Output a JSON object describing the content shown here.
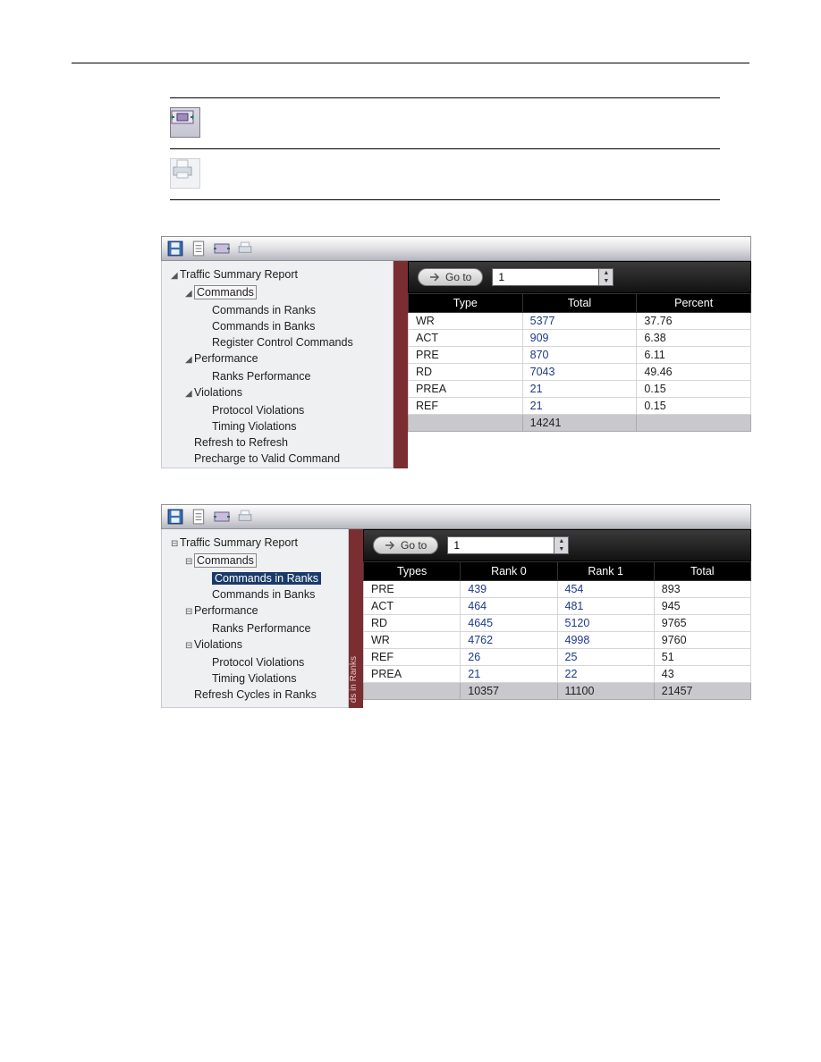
{
  "icons": [
    "expand-icon",
    "print-icon"
  ],
  "screenshot1": {
    "toolbar_icons": [
      "save-icon",
      "doc-icon",
      "expand-icon",
      "print-icon"
    ],
    "tree": [
      {
        "lvl": 1,
        "tw": "◢",
        "label": "Traffic Summary Report"
      },
      {
        "lvl": 2,
        "tw": "◢",
        "label": "Commands",
        "framed": true
      },
      {
        "lvl": 3,
        "tw": "",
        "label": "Commands in Ranks"
      },
      {
        "lvl": 3,
        "tw": "",
        "label": "Commands in Banks"
      },
      {
        "lvl": 3,
        "tw": "",
        "label": "Register Control Commands"
      },
      {
        "lvl": 2,
        "tw": "◢",
        "label": "Performance"
      },
      {
        "lvl": 3,
        "tw": "",
        "label": "Ranks Performance"
      },
      {
        "lvl": 2,
        "tw": "◢",
        "label": "Violations"
      },
      {
        "lvl": 3,
        "tw": "",
        "label": "Protocol Violations"
      },
      {
        "lvl": 3,
        "tw": "",
        "label": "Timing Violations"
      },
      {
        "lvl": 2,
        "tw": "",
        "label": "Refresh to Refresh"
      },
      {
        "lvl": 2,
        "tw": "",
        "label": "Precharge to Valid Command"
      }
    ],
    "goto_label": "Go to",
    "spin_value": "1",
    "columns": [
      "Type",
      "Total",
      "Percent"
    ],
    "rows": [
      {
        "c0": "WR",
        "c1": "5377",
        "c2": "37.76",
        "link": true
      },
      {
        "c0": "ACT",
        "c1": "909",
        "c2": "6.38",
        "link": true
      },
      {
        "c0": "PRE",
        "c1": "870",
        "c2": "6.11",
        "link": true
      },
      {
        "c0": "RD",
        "c1": "7043",
        "c2": "49.46",
        "link": true
      },
      {
        "c0": "PREA",
        "c1": "21",
        "c2": "0.15",
        "link": true
      },
      {
        "c0": "REF",
        "c1": "21",
        "c2": "0.15",
        "link": true
      }
    ],
    "total_row": {
      "c0": "",
      "c1": "14241",
      "c2": ""
    }
  },
  "screenshot2": {
    "toolbar_icons": [
      "save-icon",
      "doc-icon",
      "expand-icon",
      "print-icon"
    ],
    "tree": [
      {
        "lvl": 1,
        "tw": "⊟",
        "label": "Traffic Summary Report"
      },
      {
        "lvl": 2,
        "tw": "⊟",
        "label": "Commands",
        "framed": true
      },
      {
        "lvl": 3,
        "tw": "",
        "label": "Commands in Ranks",
        "sel": true
      },
      {
        "lvl": 3,
        "tw": "",
        "label": "Commands in Banks"
      },
      {
        "lvl": 2,
        "tw": "⊟",
        "label": "Performance"
      },
      {
        "lvl": 3,
        "tw": "",
        "label": "Ranks Performance"
      },
      {
        "lvl": 2,
        "tw": "⊟",
        "label": "Violations"
      },
      {
        "lvl": 3,
        "tw": "",
        "label": "Protocol Violations"
      },
      {
        "lvl": 3,
        "tw": "",
        "label": "Timing Violations"
      },
      {
        "lvl": 2,
        "tw": "",
        "label": "Refresh Cycles in Ranks"
      }
    ],
    "sep_label": "ds in Ranks",
    "goto_label": "Go to",
    "spin_value": "1",
    "columns": [
      "Types",
      "Rank 0",
      "Rank 1",
      "Total"
    ],
    "rows": [
      {
        "c0": "PRE",
        "c1": "439",
        "c2": "454",
        "c3": "893"
      },
      {
        "c0": "ACT",
        "c1": "464",
        "c2": "481",
        "c3": "945"
      },
      {
        "c0": "RD",
        "c1": "4645",
        "c2": "5120",
        "c3": "9765"
      },
      {
        "c0": "WR",
        "c1": "4762",
        "c2": "4998",
        "c3": "9760"
      },
      {
        "c0": "REF",
        "c1": "26",
        "c2": "25",
        "c3": "51"
      },
      {
        "c0": "PREA",
        "c1": "21",
        "c2": "22",
        "c3": "43"
      }
    ],
    "total_row": {
      "c0": "",
      "c1": "10357",
      "c2": "11100",
      "c3": "21457"
    }
  }
}
